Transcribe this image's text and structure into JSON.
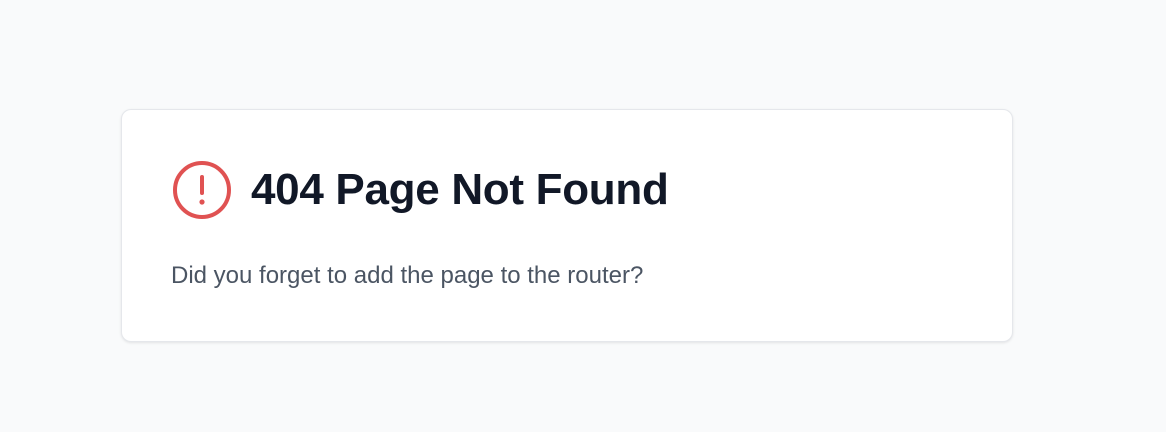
{
  "error_card": {
    "icon": "alert-circle-icon",
    "icon_color": "#e05252",
    "title": "404 Page Not Found",
    "message": "Did you forget to add the page to the router?"
  }
}
